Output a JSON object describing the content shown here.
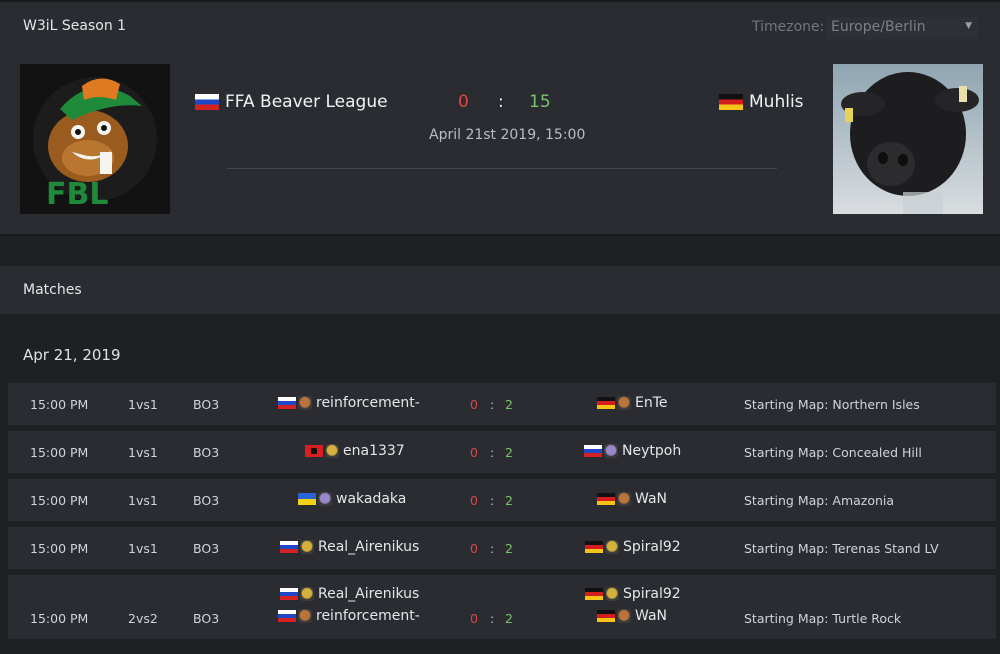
{
  "header": {
    "season_title": "W3iL Season 1",
    "timezone_label": "Timezone:",
    "timezone_value": "Europe/Berlin"
  },
  "hero": {
    "team_left": "FFA Beaver League",
    "team_left_flag": "ru",
    "team_right": "Muhlis",
    "team_right_flag": "de",
    "score_left": "0",
    "score_separator": ":",
    "score_right": "15",
    "datetime": "April 21st 2019, 15:00",
    "logo_text": "FBL"
  },
  "section": {
    "title": "Matches",
    "date_heading": "Apr 21, 2019"
  },
  "colors": {
    "loss_red": "#e0443e",
    "win_green": "#7ac36a",
    "panel_bg": "#2a2c31",
    "page_bg": "#1e2024"
  },
  "matches": [
    {
      "time": "15:00 PM",
      "mode": "1vs1",
      "format": "BO3",
      "left_players": [
        {
          "name": "reinforcement-",
          "flag": "ru",
          "race": "orc-icon"
        }
      ],
      "right_players": [
        {
          "name": "EnTe",
          "flag": "de",
          "race": "orc-icon"
        }
      ],
      "score_left": "0",
      "score_sep": ":",
      "score_right": "2",
      "map": "Starting Map: Northern Isles"
    },
    {
      "time": "15:00 PM",
      "mode": "1vs1",
      "format": "BO3",
      "left_players": [
        {
          "name": "ena1337",
          "flag": "al",
          "race": "human-icon"
        }
      ],
      "right_players": [
        {
          "name": "Neytpoh",
          "flag": "ru",
          "race": "nightelf-icon"
        }
      ],
      "score_left": "0",
      "score_sep": ":",
      "score_right": "2",
      "map": "Starting Map: Concealed Hill"
    },
    {
      "time": "15:00 PM",
      "mode": "1vs1",
      "format": "BO3",
      "left_players": [
        {
          "name": "wakadaka",
          "flag": "ua",
          "race": "nightelf-icon"
        }
      ],
      "right_players": [
        {
          "name": "WaN",
          "flag": "de",
          "race": "orc-icon"
        }
      ],
      "score_left": "0",
      "score_sep": ":",
      "score_right": "2",
      "map": "Starting Map: Amazonia"
    },
    {
      "time": "15:00 PM",
      "mode": "1vs1",
      "format": "BO3",
      "left_players": [
        {
          "name": "Real_Airenikus",
          "flag": "ru",
          "race": "human-icon"
        }
      ],
      "right_players": [
        {
          "name": "Spiral92",
          "flag": "de",
          "race": "human-icon"
        }
      ],
      "score_left": "0",
      "score_sep": ":",
      "score_right": "2",
      "map": "Starting Map: Terenas Stand LV"
    },
    {
      "time": "15:00 PM",
      "mode": "2vs2",
      "format": "BO3",
      "left_players": [
        {
          "name": "Real_Airenikus",
          "flag": "ru",
          "race": "human-icon"
        },
        {
          "name": "reinforcement-",
          "flag": "ru",
          "race": "orc-icon"
        }
      ],
      "right_players": [
        {
          "name": "Spiral92",
          "flag": "de",
          "race": "human-icon"
        },
        {
          "name": "WaN",
          "flag": "de",
          "race": "orc-icon"
        }
      ],
      "score_left": "0",
      "score_sep": ":",
      "score_right": "2",
      "map": "Starting Map: Turtle Rock"
    }
  ]
}
